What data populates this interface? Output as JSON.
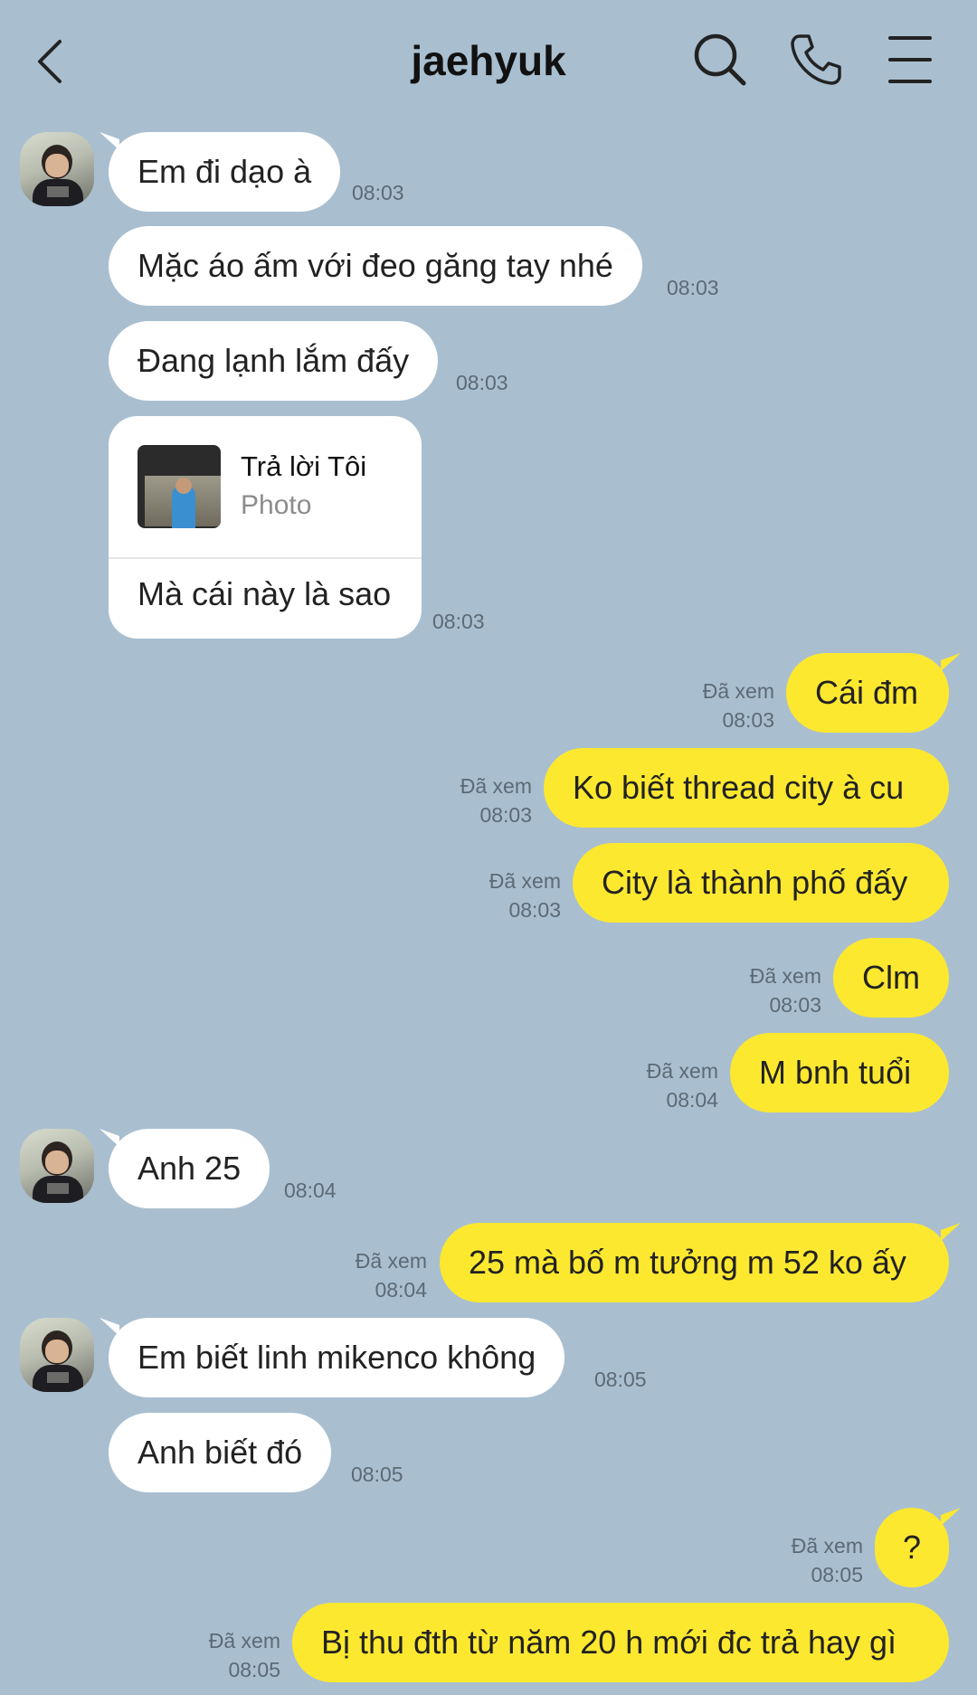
{
  "header": {
    "title": "jaehyuk",
    "icons": [
      "back-icon",
      "search-icon",
      "phone-icon",
      "menu-icon"
    ]
  },
  "colors": {
    "background": "#a9bfd0",
    "incoming_bubble": "#ffffff",
    "outgoing_bubble": "#fde830"
  },
  "messages": [
    {
      "side": "in",
      "text": "Em đi dạo à",
      "time": "08:03"
    },
    {
      "side": "in",
      "text": "Mặc áo ấm với đeo găng tay nhé",
      "time": "08:03"
    },
    {
      "side": "in",
      "text": "Đang lạnh lắm đấy",
      "time": "08:03"
    },
    {
      "side": "in",
      "reply_title": "Trả lời Tôi",
      "reply_sub": "Photo",
      "text": "Mà cái này là sao",
      "time": "08:03"
    },
    {
      "side": "out",
      "status": "Đã xem",
      "text": "Cái đm",
      "time": "08:03"
    },
    {
      "side": "out",
      "status": "Đã xem",
      "text": "Ko biết thread city à cu",
      "time": "08:03"
    },
    {
      "side": "out",
      "status": "Đã xem",
      "text": "City là thành phố đấy",
      "time": "08:03"
    },
    {
      "side": "out",
      "status": "Đã xem",
      "text": "Clm",
      "time": "08:03"
    },
    {
      "side": "out",
      "status": "Đã xem",
      "text": "M bnh tuổi",
      "time": "08:04"
    },
    {
      "side": "in",
      "text": "Anh 25",
      "time": "08:04"
    },
    {
      "side": "out",
      "status": "Đã xem",
      "text": "25 mà bố m tưởng m 52 ko ấy",
      "time": "08:04"
    },
    {
      "side": "in",
      "text": "Em biết linh mikenco không",
      "time": "08:05"
    },
    {
      "side": "in",
      "text": "Anh biết đó",
      "time": "08:05"
    },
    {
      "side": "out",
      "status": "Đã xem",
      "text": "?",
      "time": "08:05"
    },
    {
      "side": "out",
      "status": "Đã xem",
      "text": "Bị thu đth từ năm 20 h mới đc trả hay gì",
      "time": "08:05"
    }
  ]
}
